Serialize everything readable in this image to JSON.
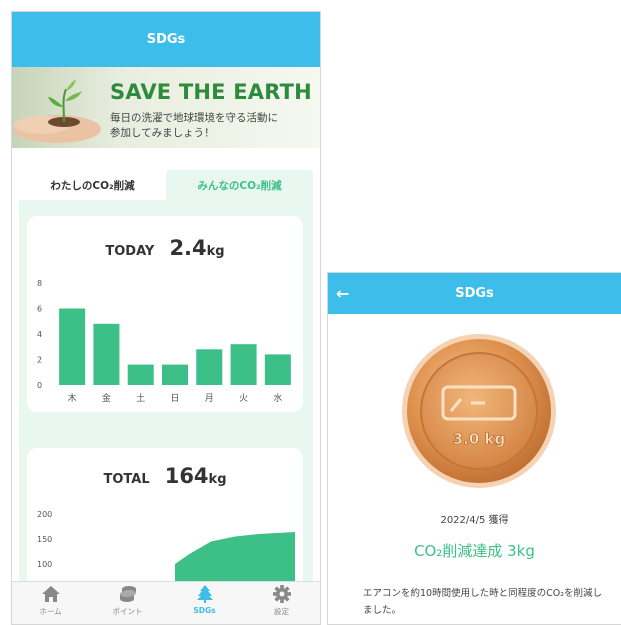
{
  "screen1": {
    "nav_title": "SDGs",
    "banner": {
      "title": "SAVE THE EARTH",
      "subtitle_line1": "毎日の洗濯で地球環境を守る活動に",
      "subtitle_line2": "参加してみましょう！"
    },
    "tabs": [
      {
        "label": "わたしのCO₂削減",
        "active": false
      },
      {
        "label": "みんなのCO₂削減",
        "active": true
      }
    ],
    "today": {
      "label": "TODAY",
      "value": "2.4",
      "unit": "kg"
    },
    "total": {
      "label": "TOTAL",
      "value": "164",
      "unit": "kg"
    },
    "tabbar": [
      {
        "label": "ホーム",
        "icon": "home-icon"
      },
      {
        "label": "ポイント",
        "icon": "coins-icon"
      },
      {
        "label": "SDGs",
        "icon": "tree-icon",
        "active": true
      },
      {
        "label": "設定",
        "icon": "gear-icon"
      }
    ]
  },
  "screen2": {
    "nav_title": "SDGs",
    "medal_text": "3.0 kg",
    "date": "2022/4/5 獲得",
    "achievement": "CO₂削減達成 3kg",
    "description": "エアコンを約10時間使用した時と同程度のCO₂を削減しました。"
  },
  "colors": {
    "nav": "#3dbdea",
    "accent_green": "#3cc088",
    "panel_bg": "#e9f7f1",
    "medal": "#d98f4e"
  },
  "chart_data": [
    {
      "type": "bar",
      "categories": [
        "木",
        "金",
        "土",
        "日",
        "月",
        "火",
        "水"
      ],
      "values": [
        6.0,
        4.8,
        1.6,
        1.6,
        2.8,
        3.2,
        2.4
      ],
      "ylim": [
        0,
        8
      ],
      "yticks": [
        0,
        2,
        4,
        6,
        8
      ],
      "color": "#3cc088",
      "grid": false
    },
    {
      "type": "area",
      "yticks_visible": [
        100,
        150,
        200
      ],
      "ylim": [
        100,
        200
      ],
      "x": [
        0.5,
        0.56,
        0.65,
        0.75,
        0.85,
        1.0
      ],
      "values": [
        100,
        120,
        145,
        155,
        160,
        164
      ],
      "color": "#3cc088",
      "grid": false
    }
  ]
}
